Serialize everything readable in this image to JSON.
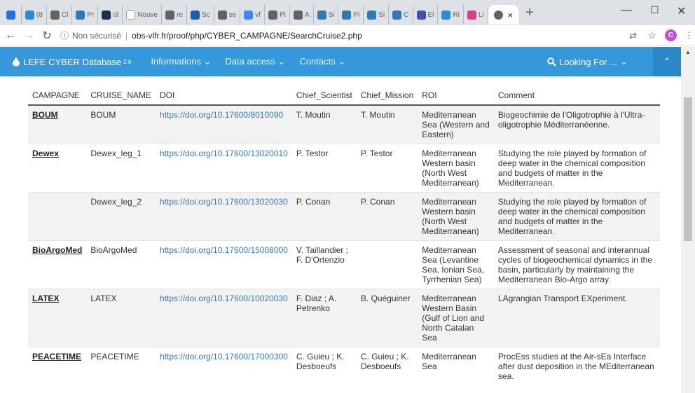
{
  "browser": {
    "tabs": [
      {
        "label": "",
        "color": "#1a73e8"
      },
      {
        "label": "(8",
        "color": "#2b8bd6"
      },
      {
        "label": "Cl",
        "color": "#5f6368"
      },
      {
        "label": "Pr",
        "color": "#2d7ab8"
      },
      {
        "label": "ol",
        "color": "#14324d"
      },
      {
        "label": "Nouve",
        "color": "#ffffff"
      },
      {
        "label": "re",
        "color": "#5f6368"
      },
      {
        "label": "Sc",
        "color": "#1560a8"
      },
      {
        "label": "se",
        "color": "#5f6368"
      },
      {
        "label": "vf",
        "color": "#4285f4"
      },
      {
        "label": "Pi",
        "color": "#5f6368"
      },
      {
        "label": "A",
        "color": "#5f6368"
      },
      {
        "label": "Si",
        "color": "#2d7ab8"
      },
      {
        "label": "Pi",
        "color": "#2d7ab8"
      },
      {
        "label": "Si",
        "color": "#2d7ab8"
      },
      {
        "label": "C",
        "color": "#2d7ab8"
      },
      {
        "label": "El",
        "color": "#3f51b5"
      },
      {
        "label": "Ri",
        "color": "#2b8bd6"
      },
      {
        "label": "Li",
        "color": "#e0398a"
      }
    ],
    "active_tab_close": "×",
    "new_tab": "+",
    "minimize": "—",
    "maximize": "☐",
    "close": "✕",
    "security": "Non sécurisé",
    "url": "obs-vlfr.fr/proof/php/CYBER_CAMPAGNE/SearchCruise2.php",
    "profile_initial": "C"
  },
  "navbar": {
    "brand": "LEFE CYBER Database",
    "brand_version": "2.0",
    "links": [
      "Informations",
      "Data access",
      "Contacts"
    ],
    "looking_for": "Looking For ..."
  },
  "table": {
    "headers": [
      "CAMPAGNE",
      "CRUISE_NAME",
      "DOI",
      "Chief_Scientist",
      "Chief_Mission",
      "ROI",
      "Comment"
    ],
    "rows": [
      [
        "BOUM",
        "BOUM",
        "https://doi.org/10.17600/8010090",
        "T. Moutin",
        "T. Moutin",
        "Mediterranean Sea (Western and Eastern)",
        "Biogeochimie de l'Oligotrophie à l'Ultra-oligotrophie Méditerranéenne."
      ],
      [
        "Dewex",
        "Dewex_leg_1",
        "https://doi.org/10.17600/13020010",
        "P. Testor",
        "P. Testor",
        "Mediterranean Western basin (North West Mediterranean)",
        "Studying the role played by formation of deep water in the chemical composition and budgets of matter in the Mediterranean."
      ],
      [
        "",
        "Dewex_leg_2",
        "https://doi.org/10.17600/13020030",
        "P. Conan",
        "P. Conan",
        "Mediterranean Western basin (North West Mediterranean)",
        "Studying the role played by formation of deep water in the chemical composition and budgets of matter in the Mediterranean."
      ],
      [
        "BioArgoMed",
        "BioArgoMed",
        "https://doi.org/10.17600/15008000",
        "V. Taillandier ; F. D'Ortenzio",
        "",
        "Mediterranean Sea (Levantine Sea, Ionian Sea, Tyrrhenian Sea)",
        "Assessment of seasonal and interannual cycles of biogeochemical dynamics in the basin, particularly by maintaining the Mediterranean Bio-Argo array."
      ],
      [
        "LATEX",
        "LATEX",
        "https://doi.org/10.17600/10020030",
        "F. Diaz ; A. Petrenko",
        "B. Quéguiner",
        "Mediterranean Western Basin (Gulf of Lion and North Catalan Sea",
        "LAgrangian Transport EXperiment."
      ],
      [
        "PEACETIME",
        "PEACETIME",
        "https://doi.org/10.17600/17000300",
        "C. Guieu ; K. Desboeufs",
        "C. Guieu ; K. Desboeufs",
        "Mediterranean Sea",
        "ProcEss studies at the Air-sEa Interface after dust deposition in the MEditerranean sea."
      ]
    ]
  }
}
